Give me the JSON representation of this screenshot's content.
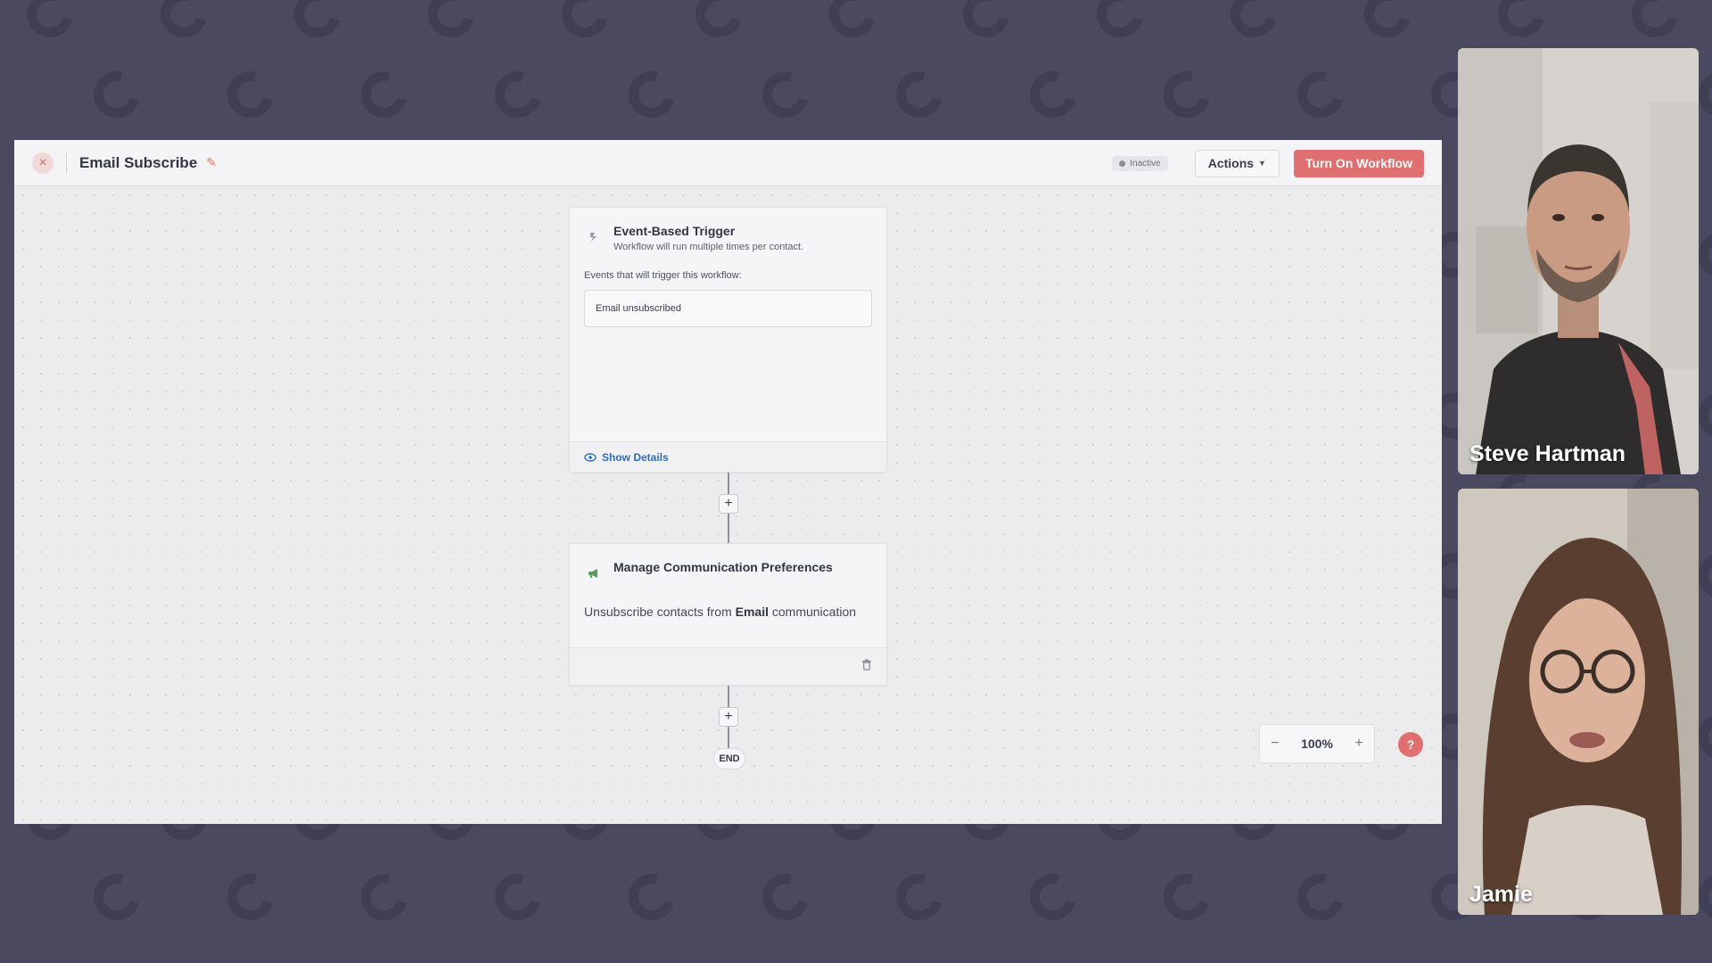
{
  "workflow": {
    "title": "Email Subscribe",
    "status": "Inactive",
    "actions_label": "Actions",
    "turn_on_label": "Turn On Workflow"
  },
  "trigger": {
    "title": "Event-Based Trigger",
    "subtitle": "Workflow will run multiple times per contact.",
    "events_label": "Events that will trigger this workflow:",
    "event": "Email unsubscribed",
    "show_details": "Show Details"
  },
  "action_step": {
    "title": "Manage Communication Preferences",
    "desc_prefix": "Unsubscribe contacts from ",
    "desc_channel": "Email",
    "desc_suffix": " communication"
  },
  "flow": {
    "plus": "+",
    "end_label": "END"
  },
  "zoom": {
    "minus": "−",
    "value": "100%",
    "plus": "+"
  },
  "help": "?",
  "participants": [
    {
      "name": "Steve Hartman"
    },
    {
      "name": "Jamie"
    }
  ]
}
